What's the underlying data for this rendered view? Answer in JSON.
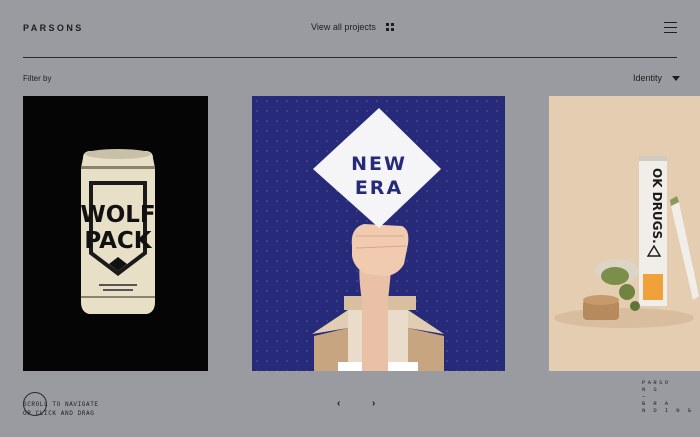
{
  "header": {
    "brand": "PARSONS",
    "view_all_label": "View all projects",
    "grid_icon": "grid-icon",
    "menu_icon": "hamburger-menu-icon"
  },
  "filter": {
    "label": "Filter by",
    "selected": "Identity"
  },
  "projects": [
    {
      "name": "Wolf Pack",
      "can_text_1": "WOLF",
      "can_text_2": "PACK"
    },
    {
      "name": "New Era",
      "sign_text_1": "NEW",
      "sign_text_2": "ERA"
    },
    {
      "name": "OK Drugs",
      "tube_text": "OK DRUGS."
    }
  ],
  "footer": {
    "scroll_hint_1": "SCROLL TO NAVIGATE",
    "scroll_hint_2": "OR CLICK AND DRAG",
    "prev_label": "‹",
    "next_label": "›",
    "branding_lines": [
      "PARSO",
      "N S",
      "—",
      "B R A",
      "N D I N G"
    ]
  },
  "colors": {
    "background": "#9a9ba0",
    "new_era_blue": "#262a78",
    "ok_drugs_beige": "#e5cdb2"
  }
}
